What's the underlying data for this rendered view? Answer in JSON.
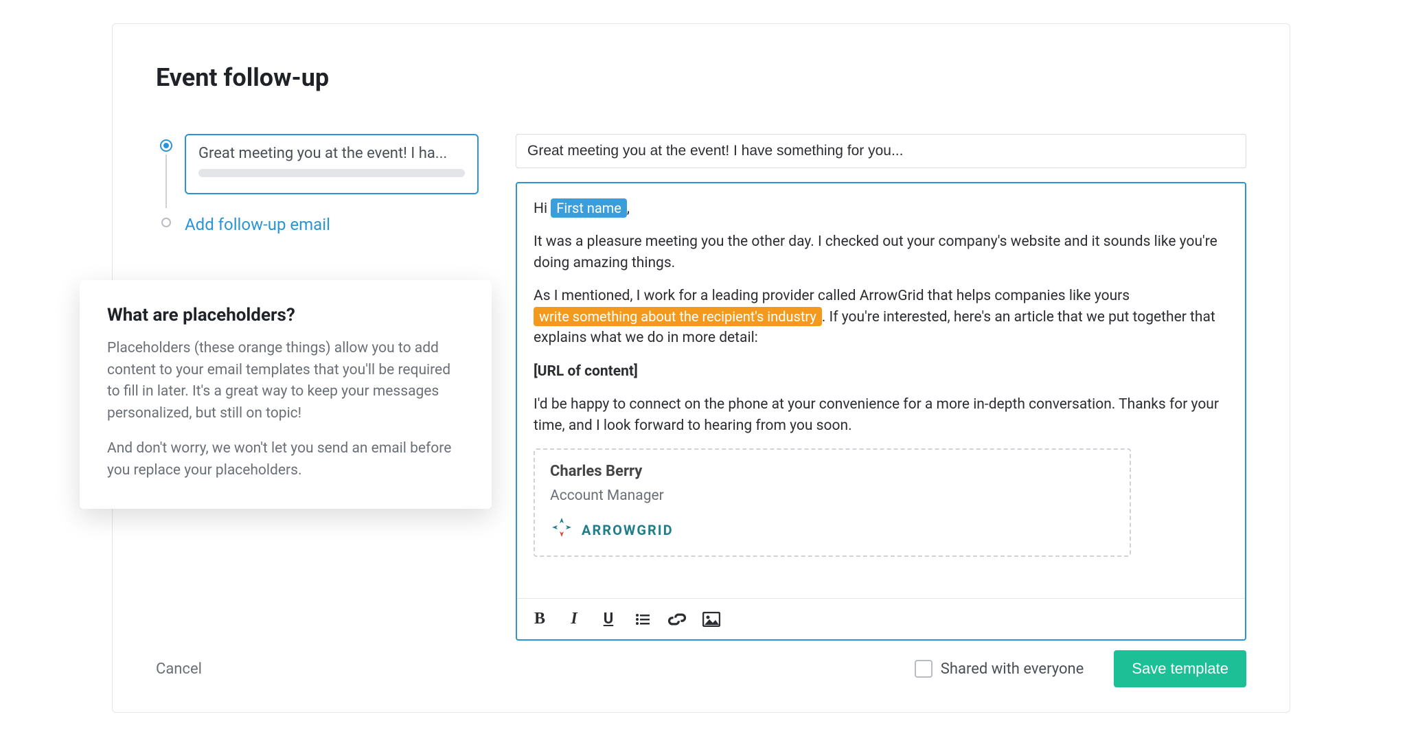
{
  "page": {
    "title": "Event follow-up"
  },
  "stepper": {
    "step1_title": "Great meeting you at the event! I ha...",
    "add_label": "Add follow-up email"
  },
  "subject": {
    "value": "Great meeting you at the event! I have something for you..."
  },
  "body": {
    "greeting_prefix": "Hi ",
    "token_first_name": "First name",
    "greeting_suffix": ",",
    "p1": "It was a pleasure meeting you the other day. I checked out your company's website and it sounds like you're doing amazing things.",
    "p2_a": "As I mentioned, I work for a leading provider called ArrowGrid that helps companies like yours ",
    "placeholder_industry": "write something about the recipient's industry",
    "p2_b": ". If you're interested, here's an article that we put together that explains what we do in more detail:",
    "url_label": "[URL of content]",
    "p3": "I'd be happy to connect on the phone at your convenience for a more in-depth conversation. Thanks for your time, and I look forward to hearing from you soon."
  },
  "signature": {
    "name": "Charles Berry",
    "title": "Account Manager",
    "company": "ARROWGRID"
  },
  "toolbar": {
    "bold": "B",
    "italic": "I",
    "underline": "U"
  },
  "footer": {
    "cancel": "Cancel",
    "share_label": "Shared with everyone",
    "save": "Save template"
  },
  "popover": {
    "title": "What are placeholders?",
    "p1": "Placeholders (these orange things) allow you to add content to your email templates that you'll be required to fill in later. It's a great way to keep your messages personalized, but still on topic!",
    "p2": "And don't worry, we won't let you send an email before you replace your placeholders."
  }
}
